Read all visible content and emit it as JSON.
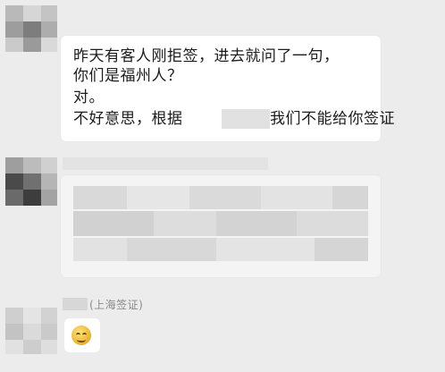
{
  "messages": [
    {
      "type": "text",
      "lines": [
        "昨天有客人刚拒签，进去就问了一句，",
        "你们是福州人？",
        "对。",
        "不好意思，根据",
        "我们不能给你签证"
      ]
    },
    {
      "type": "redacted"
    },
    {
      "type": "sticker",
      "sender_tag": "(上海签证)",
      "icon": "grinning-emoji-icon"
    }
  ],
  "colors": {
    "background": "#ececec",
    "bubble": "#ffffff",
    "text": "#1c1c1c",
    "meta": "#8a8a8a"
  }
}
